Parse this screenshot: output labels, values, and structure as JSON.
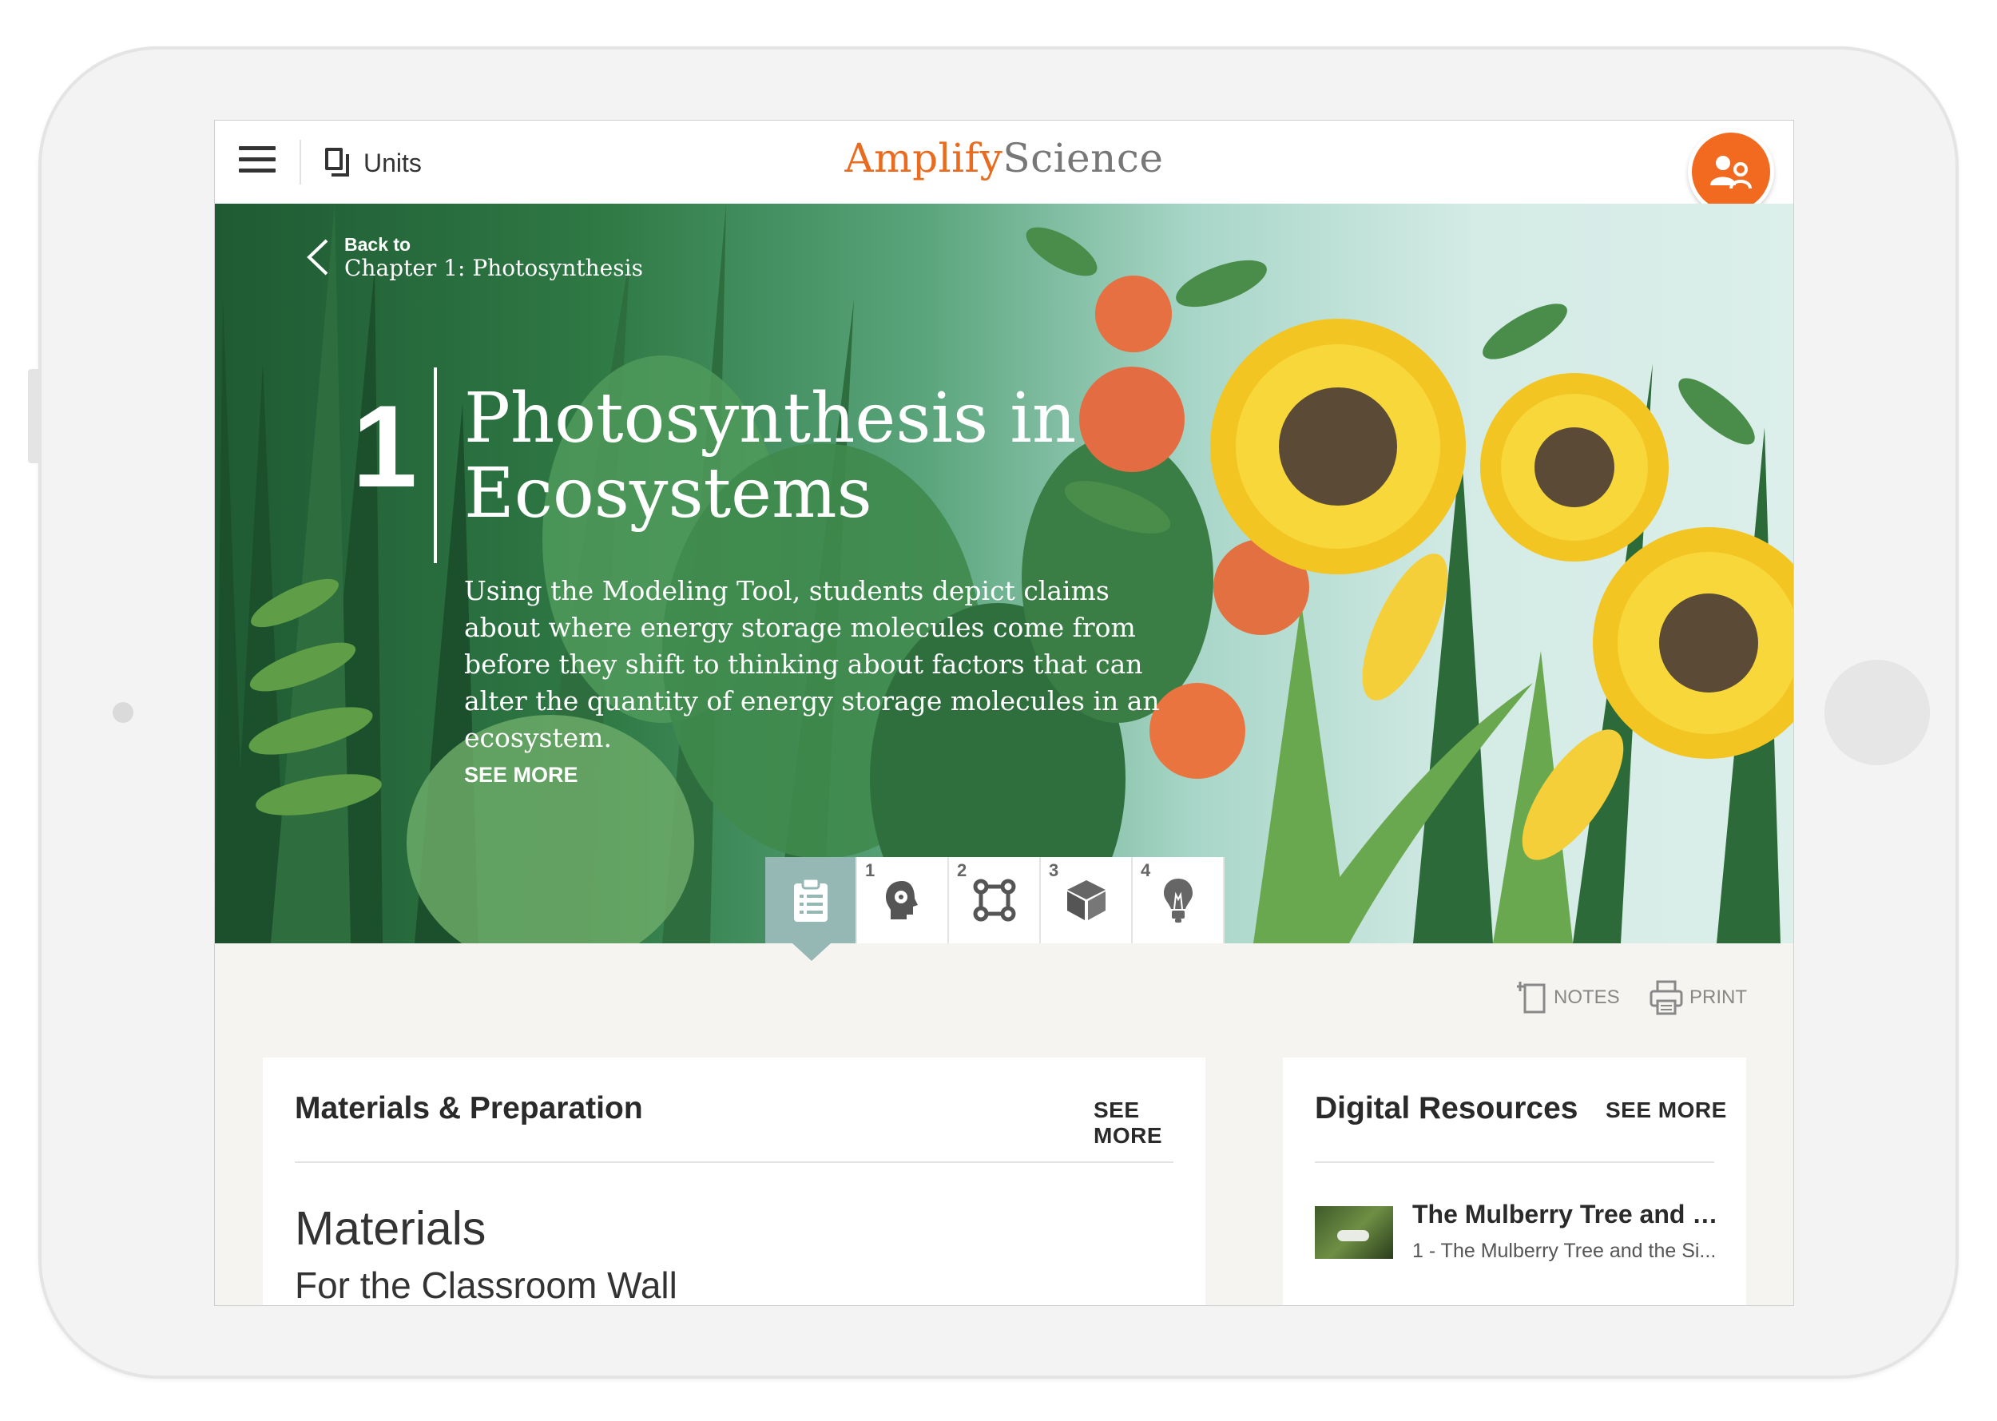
{
  "topbar": {
    "units_label": "Units",
    "logo_amplify": "Amplify",
    "logo_science": "Science",
    "avatar_icon": "user-group-icon",
    "accent_color": "#f26a1f"
  },
  "hero": {
    "back_to": "Back to",
    "back_chapter": "Chapter 1: Photosynthesis",
    "unit_number": "1",
    "unit_title": "Photosynthesis in Ecosystems",
    "description": "Using the Modeling Tool, students depict claims about where energy storage molecules come from before they shift to thinking about factors that can alter the quantity of energy storage molecules in an ecosystem.",
    "see_more": "SEE MORE"
  },
  "tabs": [
    {
      "num": "",
      "icon": "clipboard-icon",
      "active": true
    },
    {
      "num": "1",
      "icon": "head-gear-icon",
      "active": false
    },
    {
      "num": "2",
      "icon": "network-icon",
      "active": false
    },
    {
      "num": "3",
      "icon": "cube-icon",
      "active": false
    },
    {
      "num": "4",
      "icon": "lightbulb-icon",
      "active": false
    }
  ],
  "actions": {
    "notes": "NOTES",
    "print": "PRINT"
  },
  "materials_card": {
    "title": "Materials & Preparation",
    "see_more": "SEE MORE",
    "heading": "Materials",
    "subheading": "For the Classroom Wall"
  },
  "digital_card": {
    "title": "Digital Resources",
    "see_more": "SEE MORE",
    "item_title": "The Mulberry Tree and th...",
    "item_subtitle": "1 - The Mulberry Tree and the Si..."
  }
}
